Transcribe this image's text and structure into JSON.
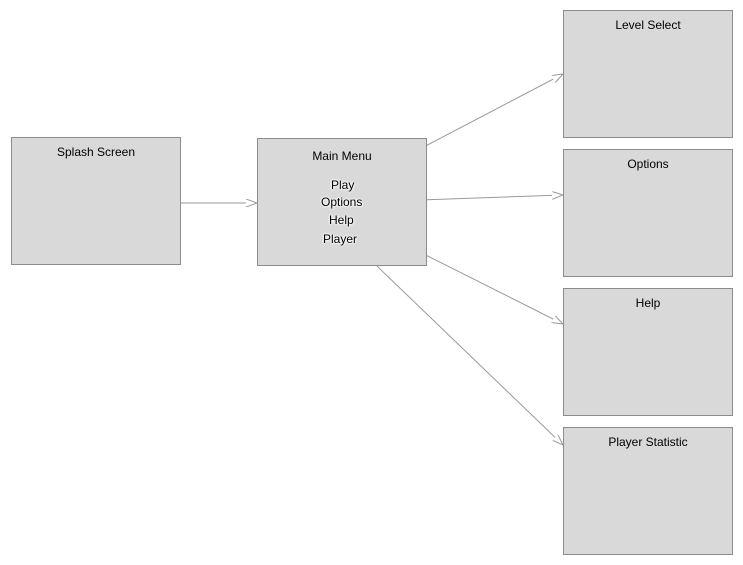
{
  "diagram": {
    "nodes": {
      "splash": {
        "title": "Splash Screen"
      },
      "main_menu": {
        "title": "Main Menu",
        "items": [
          "Play",
          "Options",
          "Help",
          "Player"
        ]
      },
      "level_select": {
        "title": "Level Select"
      },
      "options": {
        "title": "Options"
      },
      "help": {
        "title": "Help"
      },
      "player_statistic": {
        "title": "Player Statistic"
      }
    },
    "edges": [
      {
        "from": "splash",
        "to": "main_menu"
      },
      {
        "from": "main_menu.items.0",
        "to": "level_select"
      },
      {
        "from": "main_menu.items.1",
        "to": "options"
      },
      {
        "from": "main_menu.items.2",
        "to": "help"
      },
      {
        "from": "main_menu.items.3",
        "to": "player_statistic"
      }
    ],
    "colors": {
      "box_fill": "#d9d9d9",
      "box_border": "#8c8c8c",
      "connector": "#999999"
    }
  }
}
